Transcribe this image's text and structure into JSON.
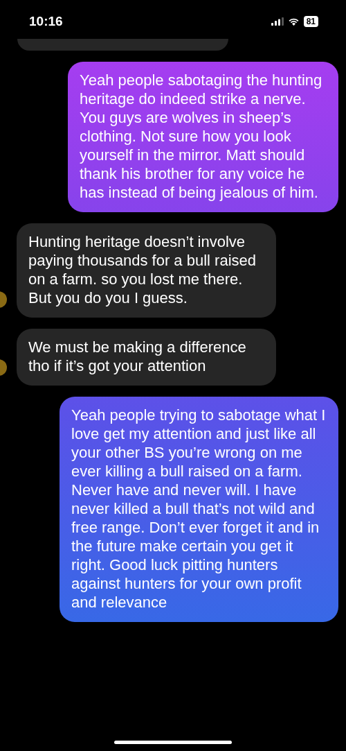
{
  "status_bar": {
    "time": "10:16",
    "battery": "81"
  },
  "messages": [
    {
      "kind": "sent",
      "avatar": false,
      "text": "Yeah people sabotaging the hunting heritage do indeed strike a nerve. You guys are wolves in sheep’s clothing. Not sure how you look yourself in the mirror. Matt should thank his brother for any voice he has instead of being jealous of him."
    },
    {
      "kind": "received",
      "avatar": true,
      "text": "Hunting heritage doesn’t involve paying thousands for a bull  raised on a farm. so you lost me there. But you do you I guess."
    },
    {
      "kind": "received",
      "avatar": true,
      "text": "We must be making a difference tho if it’s got your attention"
    },
    {
      "kind": "sent",
      "avatar": false,
      "text": "Yeah people trying to sabotage what I love get my attention and just like all your other BS you’re wrong on me ever killing a bull raised on a farm. Never have and never will. I have never killed a bull that’s not wild and free range. Don’t ever forget it and in the future make certain you get it right. Good luck pitting hunters against hunters for your own profit and relevance"
    }
  ]
}
